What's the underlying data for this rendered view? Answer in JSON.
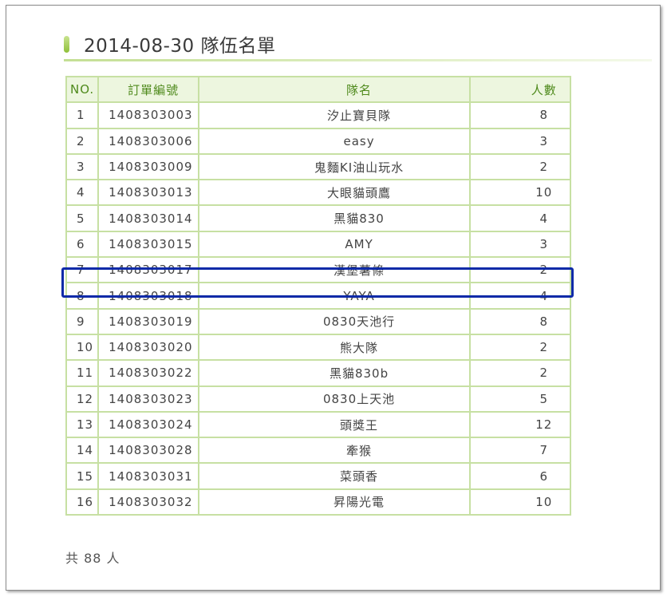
{
  "page": {
    "title": "2014-08-30 隊伍名單",
    "total": "共 88 人"
  },
  "table": {
    "headers": {
      "no": "NO.",
      "order": "訂單編號",
      "team": "隊名",
      "count": "人數"
    },
    "rows": [
      {
        "no": "1",
        "order": "1408303003",
        "team": "汐止寶貝隊",
        "count": "8"
      },
      {
        "no": "2",
        "order": "1408303006",
        "team": "easy",
        "count": "3"
      },
      {
        "no": "3",
        "order": "1408303009",
        "team": "鬼麵KI油山玩水",
        "count": "2"
      },
      {
        "no": "4",
        "order": "1408303013",
        "team": "大眼貓頭鷹",
        "count": "10"
      },
      {
        "no": "5",
        "order": "1408303014",
        "team": "黑貓830",
        "count": "4"
      },
      {
        "no": "6",
        "order": "1408303015",
        "team": "AMY",
        "count": "3"
      },
      {
        "no": "7",
        "order": "1408303017",
        "team": "漢堡薯條",
        "count": "2"
      },
      {
        "no": "8",
        "order": "1408303018",
        "team": "YAYA",
        "count": "4"
      },
      {
        "no": "9",
        "order": "1408303019",
        "team": "0830天池行",
        "count": "8"
      },
      {
        "no": "10",
        "order": "1408303020",
        "team": "熊大隊",
        "count": "2"
      },
      {
        "no": "11",
        "order": "1408303022",
        "team": "黑貓830b",
        "count": "2"
      },
      {
        "no": "12",
        "order": "1408303023",
        "team": "0830上天池",
        "count": "5"
      },
      {
        "no": "13",
        "order": "1408303024",
        "team": "頭獎王",
        "count": "12"
      },
      {
        "no": "14",
        "order": "1408303028",
        "team": "牽猴",
        "count": "7"
      },
      {
        "no": "15",
        "order": "1408303031",
        "team": "菜頭香",
        "count": "6"
      },
      {
        "no": "16",
        "order": "1408303032",
        "team": "昇陽光電",
        "count": "10"
      }
    ]
  },
  "colors": {
    "accent_green": "#8fc03a",
    "grid_border": "#c7e0a3",
    "header_text": "#4f8a1c",
    "highlight": "#0d2aa8"
  }
}
